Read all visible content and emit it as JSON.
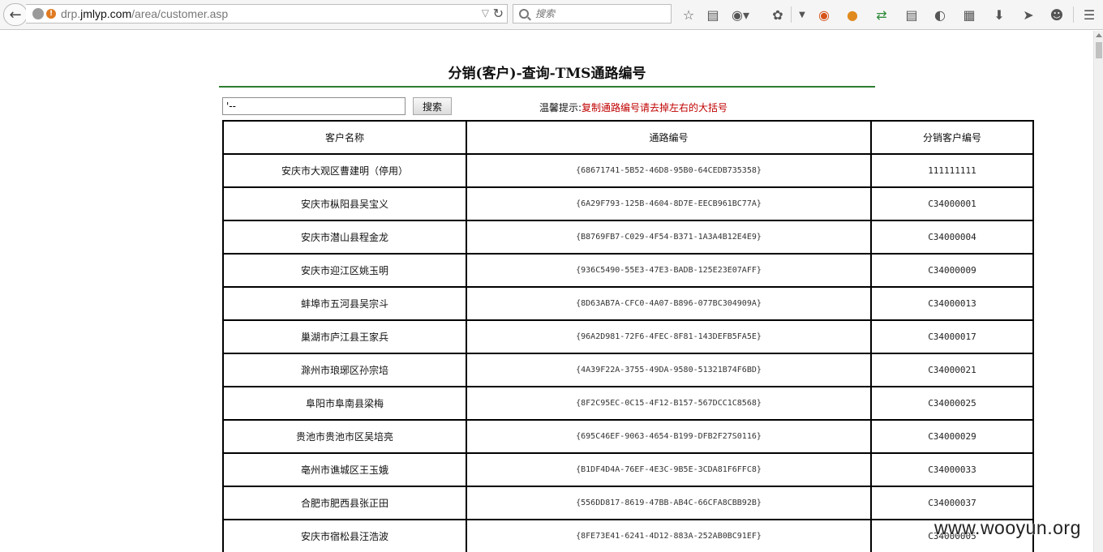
{
  "browser": {
    "url_prefix": "drp.",
    "url_domain": "jmlyp.com",
    "url_path": "/area/customer.asp",
    "search_placeholder": "搜索"
  },
  "page": {
    "title": "分销(客户)-查询-TMS通路编号",
    "query_value": "'--",
    "search_button": "搜索",
    "tip_label": "温馨提示:",
    "tip_message": "复制通路编号请去掉左右的大括号"
  },
  "table": {
    "headers": [
      "客户名称",
      "通路编号",
      "分销客户编号"
    ],
    "rows": [
      [
        "安庆市大观区曹建明（停用）",
        "{68671741-5B52-46D8-95B0-64CEDB735358}",
        "111111111"
      ],
      [
        "安庆市枞阳县吴宝义",
        "{6A29F793-125B-4604-8D7E-EECB961BC77A}",
        "C34000001"
      ],
      [
        "安庆市潜山县程金龙",
        "{B8769FB7-C029-4F54-B371-1A3A4B12E4E9}",
        "C34000004"
      ],
      [
        "安庆市迎江区姚玉明",
        "{936C5490-55E3-47E3-BADB-125E23E07AFF}",
        "C34000009"
      ],
      [
        "蚌埠市五河县吴宗斗",
        "{8D63AB7A-CFC0-4A07-B896-077BC304909A}",
        "C34000013"
      ],
      [
        "巢湖市庐江县王家兵",
        "{96A2D981-72F6-4FEC-8F81-143DEFB5FA5E}",
        "C34000017"
      ],
      [
        "滁州市琅琊区孙宗培",
        "{4A39F22A-3755-49DA-9580-51321B74F6BD}",
        "C34000021"
      ],
      [
        "阜阳市阜南县梁梅",
        "{8F2C95EC-0C15-4F12-B157-567DCC1C8568}",
        "C34000025"
      ],
      [
        "贵池市贵池市区吴培亮",
        "{695C46EF-9063-4654-B199-DFB2F27S0116}",
        "C34000029"
      ],
      [
        "亳州市谯城区王玉娥",
        "{B1DF4D4A-76EF-4E3C-9B5E-3CDA81F6FFC8}",
        "C34000033"
      ],
      [
        "合肥市肥西县张正田",
        "{556DD817-8619-47BB-AB4C-66CFA8CBB92B}",
        "C34000037"
      ],
      [
        "安庆市宿松县汪浩波",
        "{8FE73E41-6241-4D12-883A-252AB0BC91EF}",
        "C34000005"
      ]
    ]
  },
  "watermark": "www.wooyun.org"
}
